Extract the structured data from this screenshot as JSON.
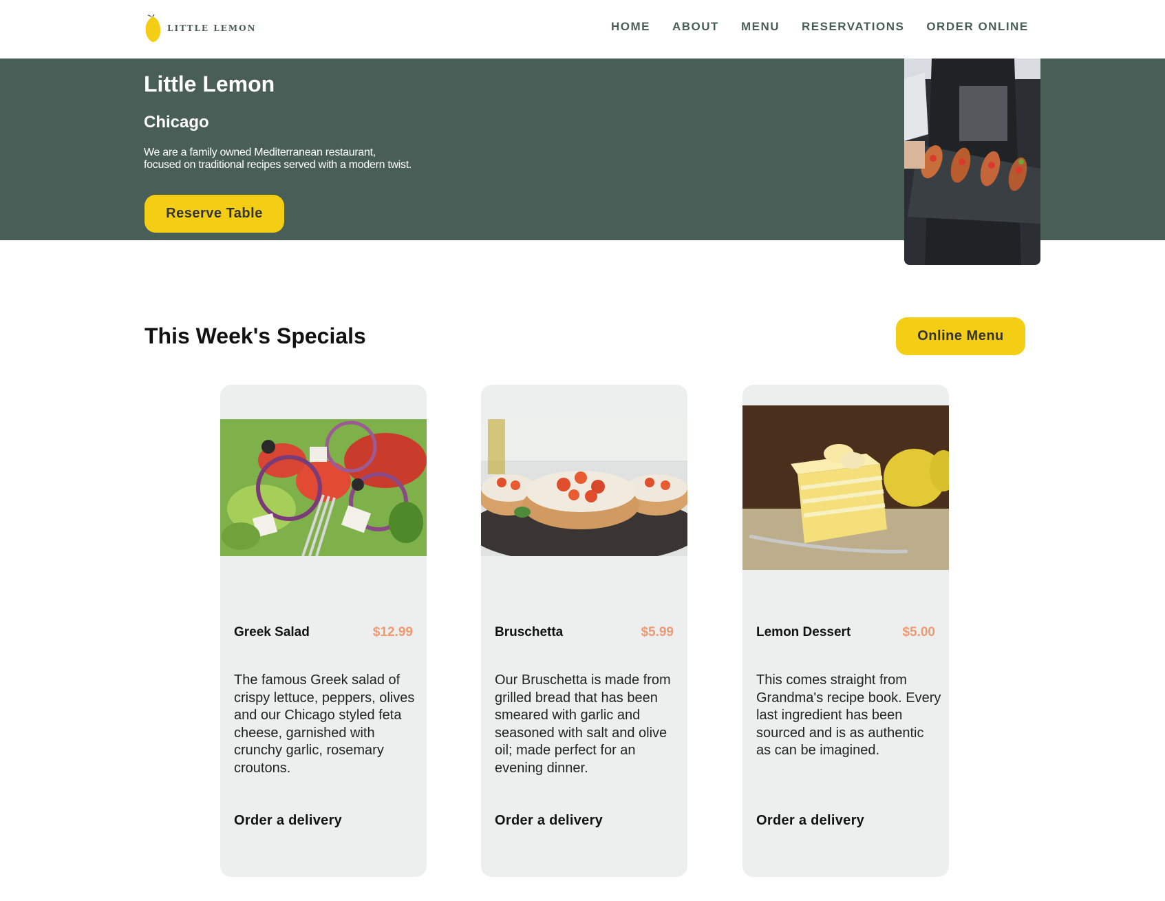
{
  "header": {
    "logo_text": "LITTLE LEMON",
    "nav": [
      "HOME",
      "ABOUT",
      "MENU",
      "RESERVATIONS",
      "ORDER ONLINE"
    ]
  },
  "hero": {
    "title": "Little Lemon",
    "subtitle": "Chicago",
    "description": "We are a family owned Mediterranean restaurant, focused on traditional recipes served with a modern twist.",
    "cta_label": "Reserve Table"
  },
  "specials": {
    "title": "This Week's Specials",
    "menu_button": "Online Menu",
    "cards": [
      {
        "name": "Greek Salad",
        "price": "$12.99",
        "description": "The famous Greek salad of crispy lettuce, peppers, olives and our Chicago styled feta cheese, garnished with crunchy garlic, rosemary croutons.",
        "order_label": "Order a delivery"
      },
      {
        "name": "Bruschetta",
        "price": "$5.99",
        "description": "Our Bruschetta is made from grilled bread that has been smeared with garlic and seasoned with salt and olive oil; made perfect for an evening dinner.",
        "order_label": "Order a delivery"
      },
      {
        "name": "Lemon Dessert",
        "price": "$5.00",
        "description": "This comes straight from Grandma's recipe book. Every last ingredient has been sourced and is as authentic as can be imagined.",
        "order_label": "Order a delivery"
      }
    ]
  },
  "colors": {
    "primary_green": "#495e57",
    "primary_yellow": "#f4ce14",
    "price_salmon": "#ee9972",
    "card_bg": "#edefee"
  },
  "icons": [
    "lemon-logo-icon"
  ]
}
